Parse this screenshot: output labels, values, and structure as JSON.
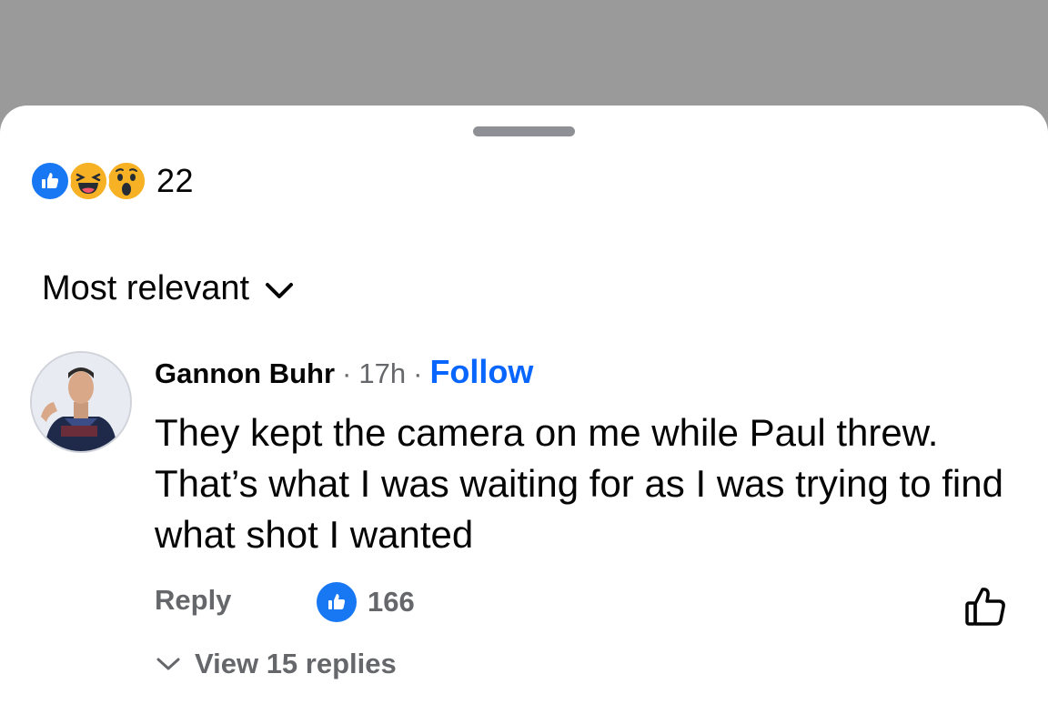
{
  "reactions": {
    "icons": [
      "like-icon",
      "haha-icon",
      "wow-icon"
    ],
    "count": "22"
  },
  "sort": {
    "label": "Most relevant"
  },
  "comment": {
    "author": "Gannon Buhr",
    "separator": "·",
    "time": "17h",
    "follow_label": "Follow",
    "text": "They kept the camera on me while Paul threw. That’s what I was waiting for as I was trying to find what shot I wanted",
    "reply_label": "Reply",
    "like_count": "166",
    "view_replies_label": "View 15 replies"
  },
  "colors": {
    "accent": "#0866ff",
    "like_blue": "#1877f2",
    "secondary_text": "#65676b",
    "backdrop": "#9a9a9a"
  }
}
